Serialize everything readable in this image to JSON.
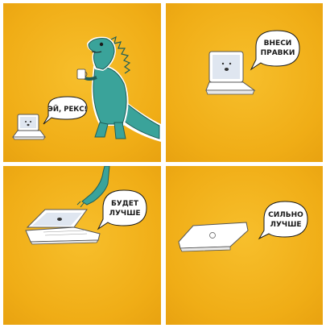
{
  "panels": [
    {
      "id": "panel-1",
      "speech": "ЭЙ, РЕКС!"
    },
    {
      "id": "panel-2",
      "speech_line1": "ВНЕСИ",
      "speech_line2": "ПРАВКИ"
    },
    {
      "id": "panel-3",
      "speech_line1": "БУДЕТ",
      "speech_line2": "ЛУЧШЕ"
    },
    {
      "id": "panel-4",
      "speech_line1": "СИЛЬНО",
      "speech_line2": "ЛУЧШЕ"
    }
  ],
  "colors": {
    "background": "#f2b21c",
    "dino": "#3aa39a",
    "paper": "#ffffff",
    "ink": "#1a1a1a"
  }
}
